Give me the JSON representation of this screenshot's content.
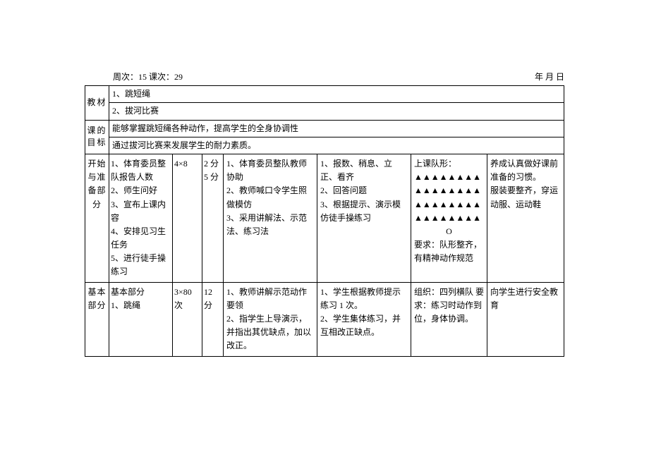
{
  "header": {
    "left": "周次：15 课次：29",
    "right": "年 月 日"
  },
  "jiaocai_label": "教材",
  "jiaocai1": "1、跳短绳",
  "jiaocai2": "2、拔河比赛",
  "mubiao_label": "课的目标",
  "mubiao1": "能够掌握跳短绳各种动作，提高学生的全身协调性",
  "mubiao2": "通过拔河比赛来发展学生的耐力素质。",
  "sections": {
    "start": {
      "label": "开始与准备部分",
      "activities": "1、体育委员整队报告人数\n2、师生问好\n3、宣布上课内容\n4、安排见习生任务\n5、进行徒手操练习",
      "reps": "4×8",
      "time": "2 分\n5 分",
      "teacher": "1、体育委员整队教师协助\n2、教师喊口令学生照做模仿\n3、采用讲解法、示范法、练习法",
      "student": "1、报数、稍息、立正、看齐\n2、回答问题\n3、根据提示、演示模仿徒手操练习",
      "org_title": "上课队形：",
      "org_rows": [
        "▲▲▲▲▲▲▲▲",
        "▲▲▲▲▲▲▲▲",
        "▲▲▲▲▲▲▲▲",
        "▲▲▲▲▲▲▲▲"
      ],
      "org_mark": "O",
      "org_req": "要求：队形整齐，有精神动作规范",
      "note": "养成认真做好课前准备的习惯。\n服装要整齐，穿运动服、运动鞋"
    },
    "basic": {
      "label": "基本部分",
      "activities": "基本部分\n1、跳绳",
      "reps": "3×80 次",
      "time": "12 分",
      "teacher": "1、教师讲解示范动作要领\n2、指学生上导演示，并指出其优缺点，加以改正。",
      "student": "1、学生根据教师提示练习 1 次。\n2、学生集体练习，并互相改正缺点。",
      "org": "组织：四列横队 要求：练习时动作到位，身体协调。",
      "note": "向学生进行安全教育"
    }
  }
}
